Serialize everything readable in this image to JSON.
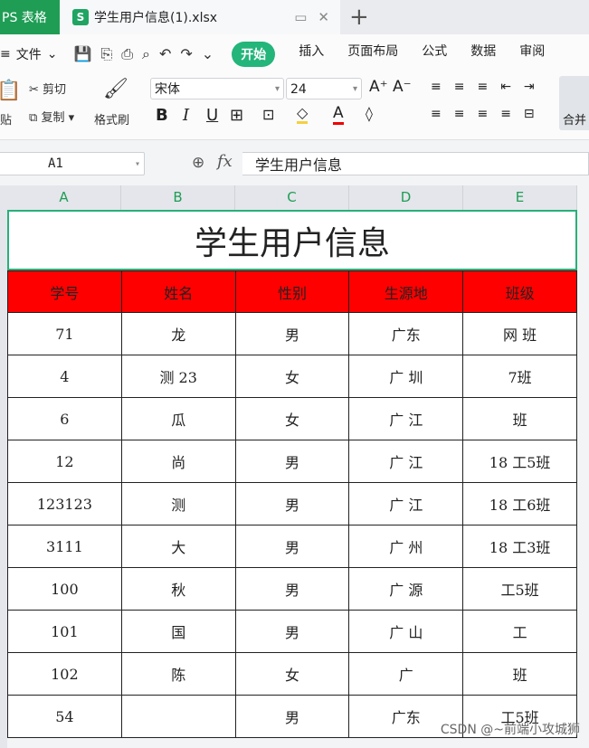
{
  "titlebar": {
    "app_tab": "PS 表格",
    "doc_icon": "S",
    "doc_title": "学生用户信息(1).xlsx",
    "plus": "+"
  },
  "ribbon": {
    "file_menu": "文件",
    "tabs": [
      "开始",
      "插入",
      "页面布局",
      "公式",
      "数据",
      "审阅"
    ]
  },
  "toolbar": {
    "paste": "贴",
    "cut": "剪切",
    "copy": "复制",
    "format_painter": "格式刷",
    "font_name": "宋体",
    "font_size": "24",
    "merge": "合并"
  },
  "formula": {
    "cell_ref": "A1",
    "fx": "fx",
    "value": "学生用户信息"
  },
  "sheet": {
    "columns": [
      "A",
      "B",
      "C",
      "D",
      "E"
    ],
    "title": "学生用户信息",
    "headers": [
      "学号",
      "姓名",
      "性别",
      "生源地",
      "班级"
    ],
    "rows": [
      [
        "71",
        "龙",
        "男",
        "广东",
        "网 班"
      ],
      [
        "4",
        "测 23",
        "女",
        "广 圳",
        "7班"
      ],
      [
        "6",
        "瓜",
        "女",
        "广 江",
        "班"
      ],
      [
        "12",
        "尚",
        "男",
        "广 江",
        "18 工5班"
      ],
      [
        "123123",
        "测",
        "男",
        "广 江",
        "18 工6班"
      ],
      [
        "3111",
        "大",
        "男",
        "广 州",
        "18 工3班"
      ],
      [
        "100",
        "秋",
        "男",
        "广 源",
        "工5班"
      ],
      [
        "101",
        "国",
        "男",
        "广 山",
        "工"
      ],
      [
        "102",
        "陈",
        "女",
        "广",
        "班"
      ],
      [
        "54",
        "",
        "男",
        "广东",
        "工5班"
      ]
    ]
  },
  "watermark": "CSDN @~前端小攻城狮"
}
